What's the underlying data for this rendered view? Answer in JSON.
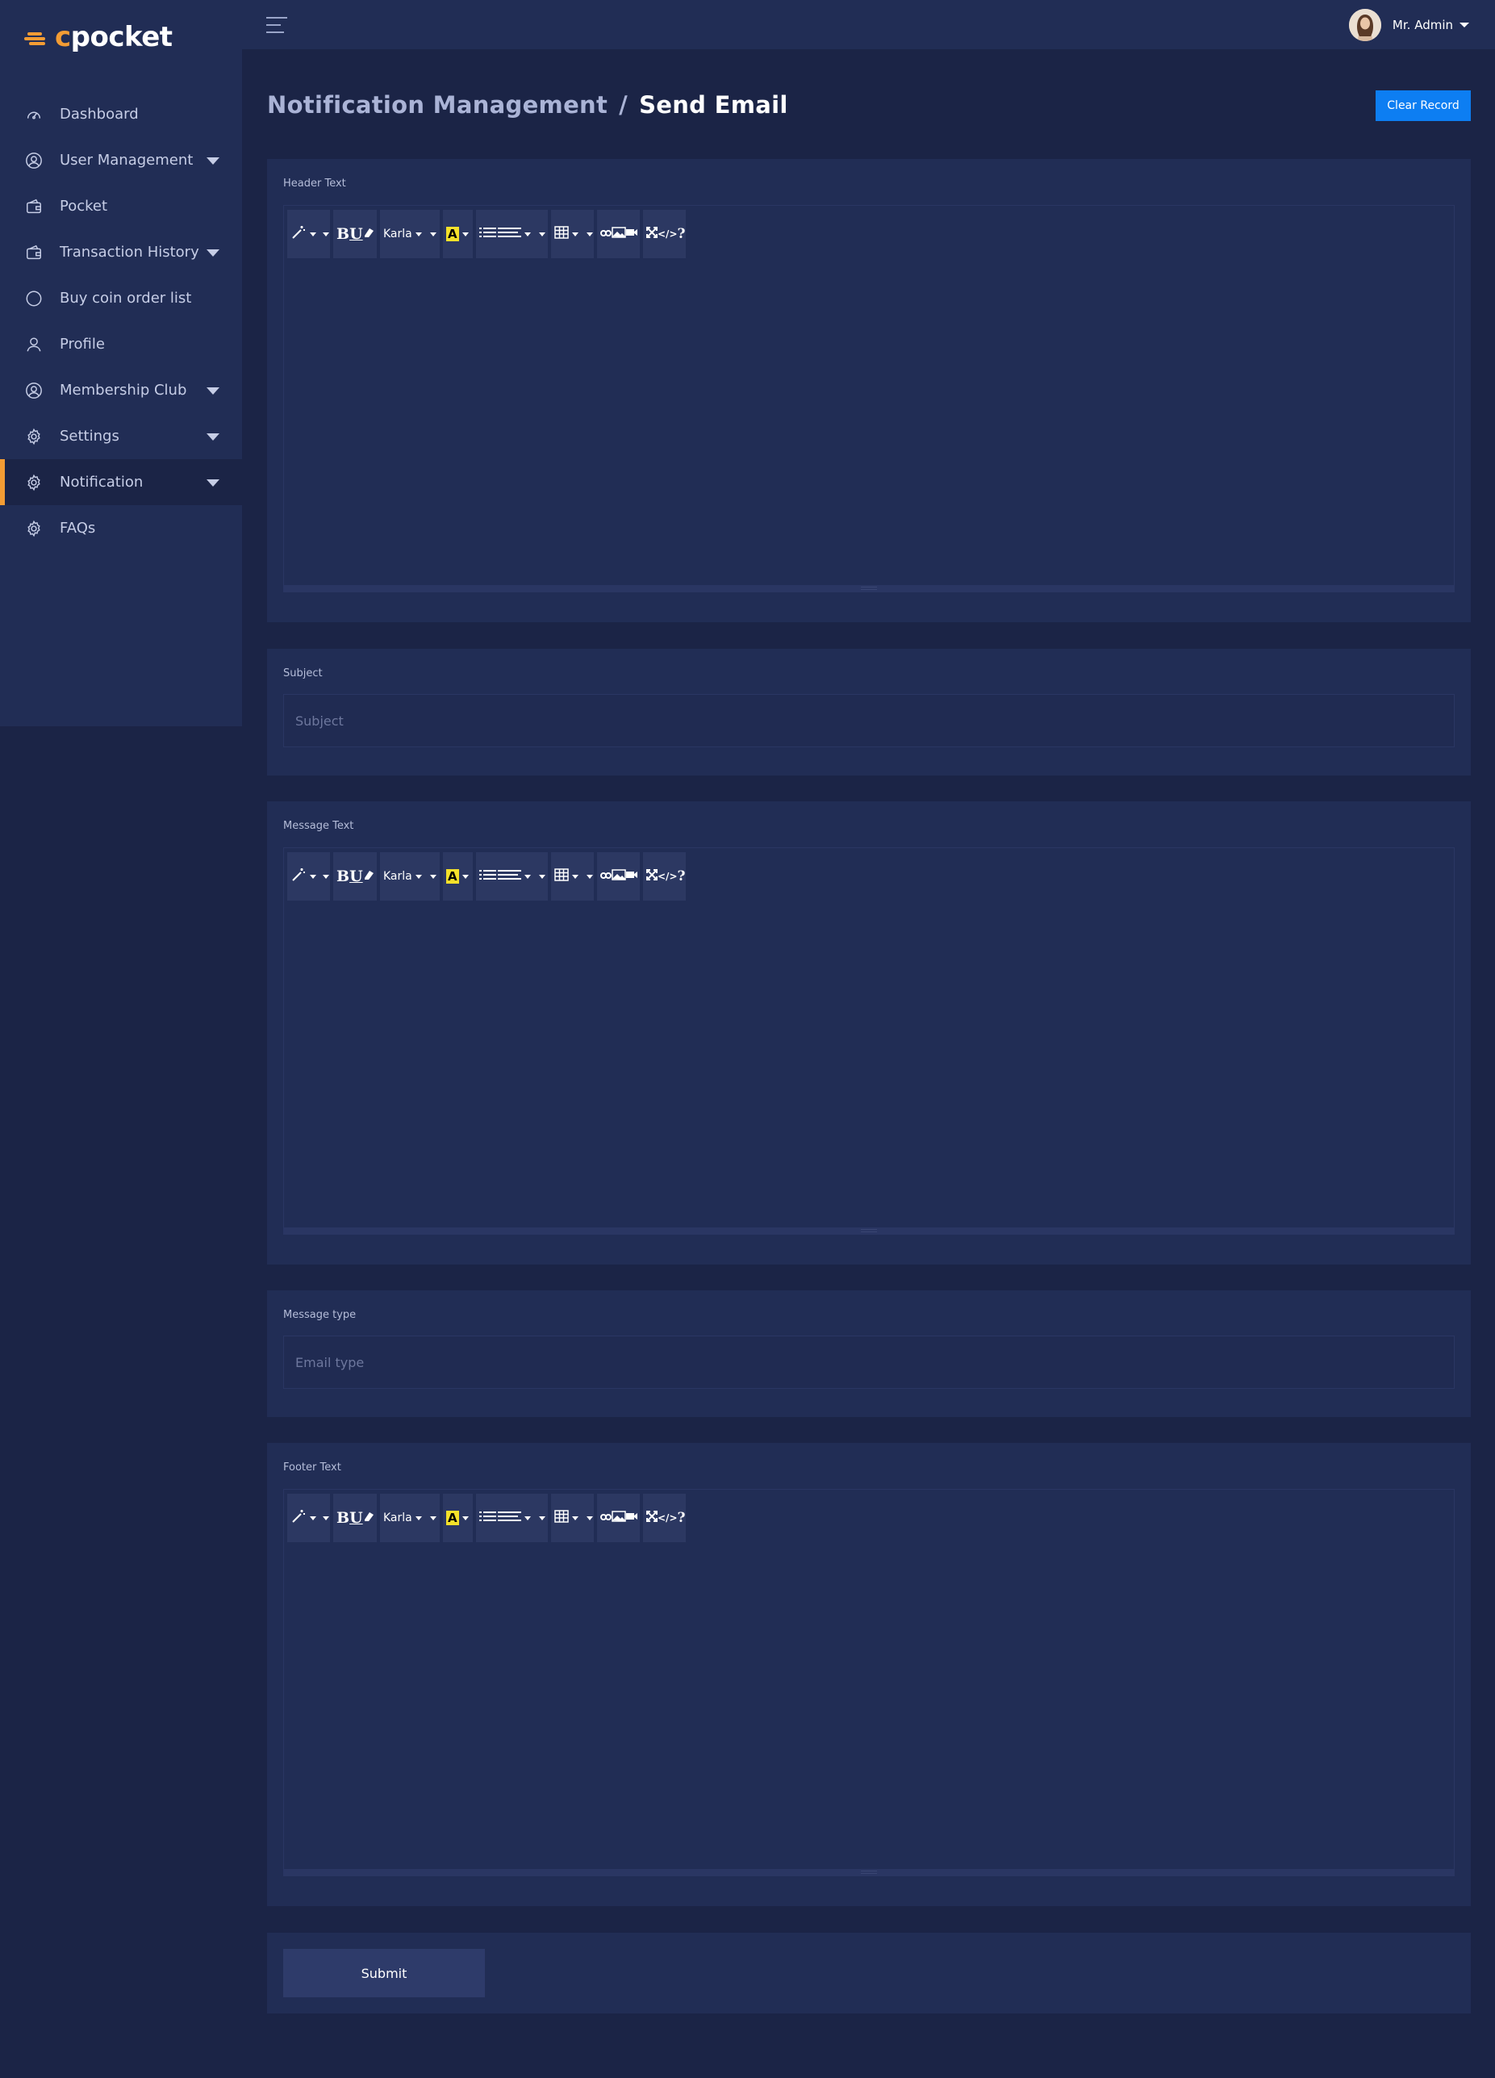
{
  "app": {
    "logo_prefix": "c",
    "logo_rest": "pocket",
    "brand_color": "#f39c34"
  },
  "sidebar": {
    "items": [
      {
        "label": "Dashboard",
        "icon": "speedometer-icon",
        "has_submenu": false,
        "active": false
      },
      {
        "label": "User Management",
        "icon": "user-circle-icon",
        "has_submenu": true,
        "active": false
      },
      {
        "label": "Pocket",
        "icon": "wallet-icon",
        "has_submenu": false,
        "active": false
      },
      {
        "label": "Transaction History",
        "icon": "wallet-icon",
        "has_submenu": true,
        "active": false
      },
      {
        "label": "Buy coin order list",
        "icon": "circle-icon",
        "has_submenu": false,
        "active": false
      },
      {
        "label": "Profile",
        "icon": "user-icon",
        "has_submenu": false,
        "active": false
      },
      {
        "label": "Membership Club",
        "icon": "user-circle-icon",
        "has_submenu": true,
        "active": false
      },
      {
        "label": "Settings",
        "icon": "gear-icon",
        "has_submenu": true,
        "active": false
      },
      {
        "label": "Notification",
        "icon": "gear-icon",
        "has_submenu": true,
        "active": true
      },
      {
        "label": "FAQs",
        "icon": "gear-icon",
        "has_submenu": false,
        "active": false
      }
    ]
  },
  "header": {
    "user_name": "Mr. Admin"
  },
  "page": {
    "breadcrumb_parent": "Notification Management",
    "breadcrumb_separator": "/",
    "title": "Send Email",
    "clear_button": "Clear Record"
  },
  "form": {
    "header_text_label": "Header Text",
    "subject_label": "Subject",
    "subject_placeholder": "Subject",
    "message_text_label": "Message Text",
    "message_type_label": "Message type",
    "message_type_placeholder": "Email type",
    "footer_text_label": "Footer Text",
    "submit_label": "Submit"
  },
  "editor_toolbar": {
    "font_name": "Karla",
    "bold_glyph": "B",
    "underline_glyph": "U",
    "highlight_glyph": "A",
    "help_glyph": "?",
    "code_glyph": "</>"
  }
}
